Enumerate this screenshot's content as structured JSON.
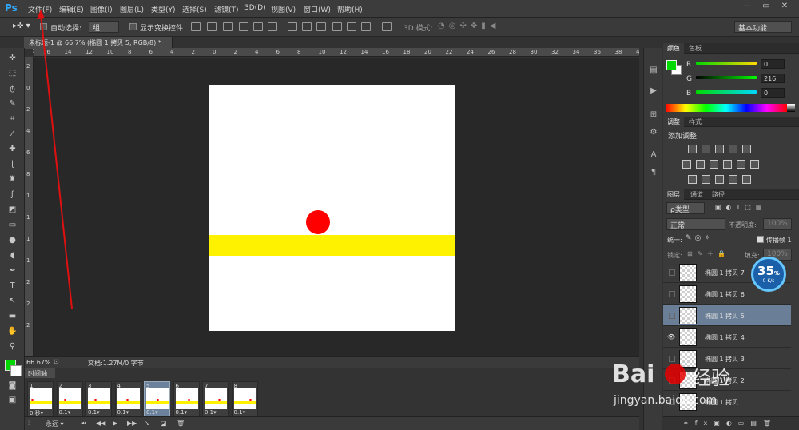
{
  "app": {
    "logo": "Ps"
  },
  "menu": [
    "文件(F)",
    "编辑(E)",
    "图像(I)",
    "图层(L)",
    "类型(Y)",
    "选择(S)",
    "滤镜(T)",
    "3D(D)",
    "视图(V)",
    "窗口(W)",
    "帮助(H)"
  ],
  "window_buttons": [
    "—",
    "▭",
    "✕"
  ],
  "options_bar": {
    "auto_select_label": "自动选择:",
    "auto_select_value": "组",
    "show_transform_label": "显示变换控件",
    "mode_3d_label": "3D 模式:",
    "workspace_value": "基本功能"
  },
  "document_tab": {
    "title": "未标题-1 @ 66.7% (椭圆 1 拷贝 5, RGB/8) *",
    "close": "×"
  },
  "ruler_top_labels": [
    "16",
    "14",
    "12",
    "10",
    "8",
    "6",
    "4",
    "2",
    "0",
    "2",
    "4",
    "6",
    "8",
    "10",
    "12",
    "14",
    "16",
    "18",
    "20",
    "22",
    "24",
    "26",
    "28",
    "30",
    "32",
    "34",
    "36",
    "38",
    "40"
  ],
  "ruler_left_labels": [
    "2",
    "0",
    "2",
    "4",
    "6",
    "8",
    "1",
    "1",
    "1",
    "1",
    "2",
    "2",
    "2"
  ],
  "status": {
    "zoom": "66.67%",
    "doc_info": "文档:1.27M/0 字节"
  },
  "timeline": {
    "tab": "时间轴",
    "selected_frame": 5,
    "frames": [
      {
        "num": "1",
        "delay": "0 秒▾"
      },
      {
        "num": "2",
        "delay": "0.1▾"
      },
      {
        "num": "3",
        "delay": "0.1▾"
      },
      {
        "num": "4",
        "delay": "0.1▾"
      },
      {
        "num": "5",
        "delay": "0.1▾"
      },
      {
        "num": "6",
        "delay": "0.1▾"
      },
      {
        "num": "7",
        "delay": "0.1▾"
      },
      {
        "num": "8",
        "delay": "0.1▾"
      }
    ],
    "loop_value": "永远"
  },
  "color_panel": {
    "tabs": [
      "颜色",
      "色板"
    ],
    "channels": [
      {
        "label": "R",
        "value": "0"
      },
      {
        "label": "G",
        "value": "216"
      },
      {
        "label": "B",
        "value": "0"
      }
    ],
    "foreground": "#00d800"
  },
  "adjustments_panel": {
    "tabs": [
      "调整",
      "样式"
    ],
    "heading": "添加调整"
  },
  "layers_panel": {
    "tabs": [
      "图层",
      "通道",
      "路径"
    ],
    "filter_type": "ρ类型",
    "blend_mode": "正常",
    "opacity_label": "不透明度:",
    "opacity_value": "100%",
    "unify_label": "统一:",
    "propagate_label": "传播帧 1",
    "lock_label": "锁定:",
    "fill_label": "填充:",
    "fill_value": "100%",
    "layers": [
      {
        "name": "椭圆 1 拷贝 7",
        "visible": false,
        "selected": false
      },
      {
        "name": "椭圆 1 拷贝 6",
        "visible": false,
        "selected": false
      },
      {
        "name": "椭圆 1 拷贝 5",
        "visible": false,
        "selected": true
      },
      {
        "name": "椭圆 1 拷贝 4",
        "visible": true,
        "selected": false
      },
      {
        "name": "椭圆 1 拷贝 3",
        "visible": false,
        "selected": false
      },
      {
        "name": "椭圆 1 拷贝 2",
        "visible": false,
        "selected": false
      },
      {
        "name": "椭圆 1 拷贝",
        "visible": false,
        "selected": false
      }
    ]
  },
  "speed_badge": {
    "percent": "35",
    "unit": "%",
    "rate": "0 K/s"
  },
  "watermark": {
    "brand": "Bai",
    "brand2": "经验",
    "url": "jingyan.baidu.com"
  }
}
